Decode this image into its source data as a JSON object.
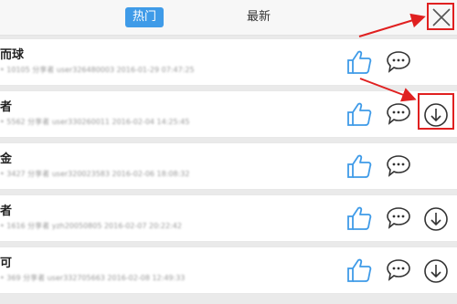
{
  "tabs": {
    "hot": "热门",
    "latest": "最新"
  },
  "rows": [
    {
      "title": "而球",
      "meta": "• 10105  分享者  user326480003  2016-01-29 07:47:25"
    },
    {
      "title": "者",
      "meta": "• 5562  分享者  user330260011  2016-02-04 14:25:45"
    },
    {
      "title": "金",
      "meta": "• 3427  分享者  user320023583  2016-02-06 18:08:32"
    },
    {
      "title": "者",
      "meta": "• 1616  分享者  yzh20050805  2016-02-07 20:22:42"
    },
    {
      "title": "可",
      "meta": "• 369  分享者  user332705663  2016-02-08 12:49:33"
    }
  ],
  "icons": {
    "like": "thumbs-up-icon",
    "comment": "comment-bubble-icon",
    "download": "download-circle-icon",
    "close": "close-x-icon"
  },
  "colors": {
    "accent": "#3f9be8",
    "annotation": "#e02020"
  }
}
